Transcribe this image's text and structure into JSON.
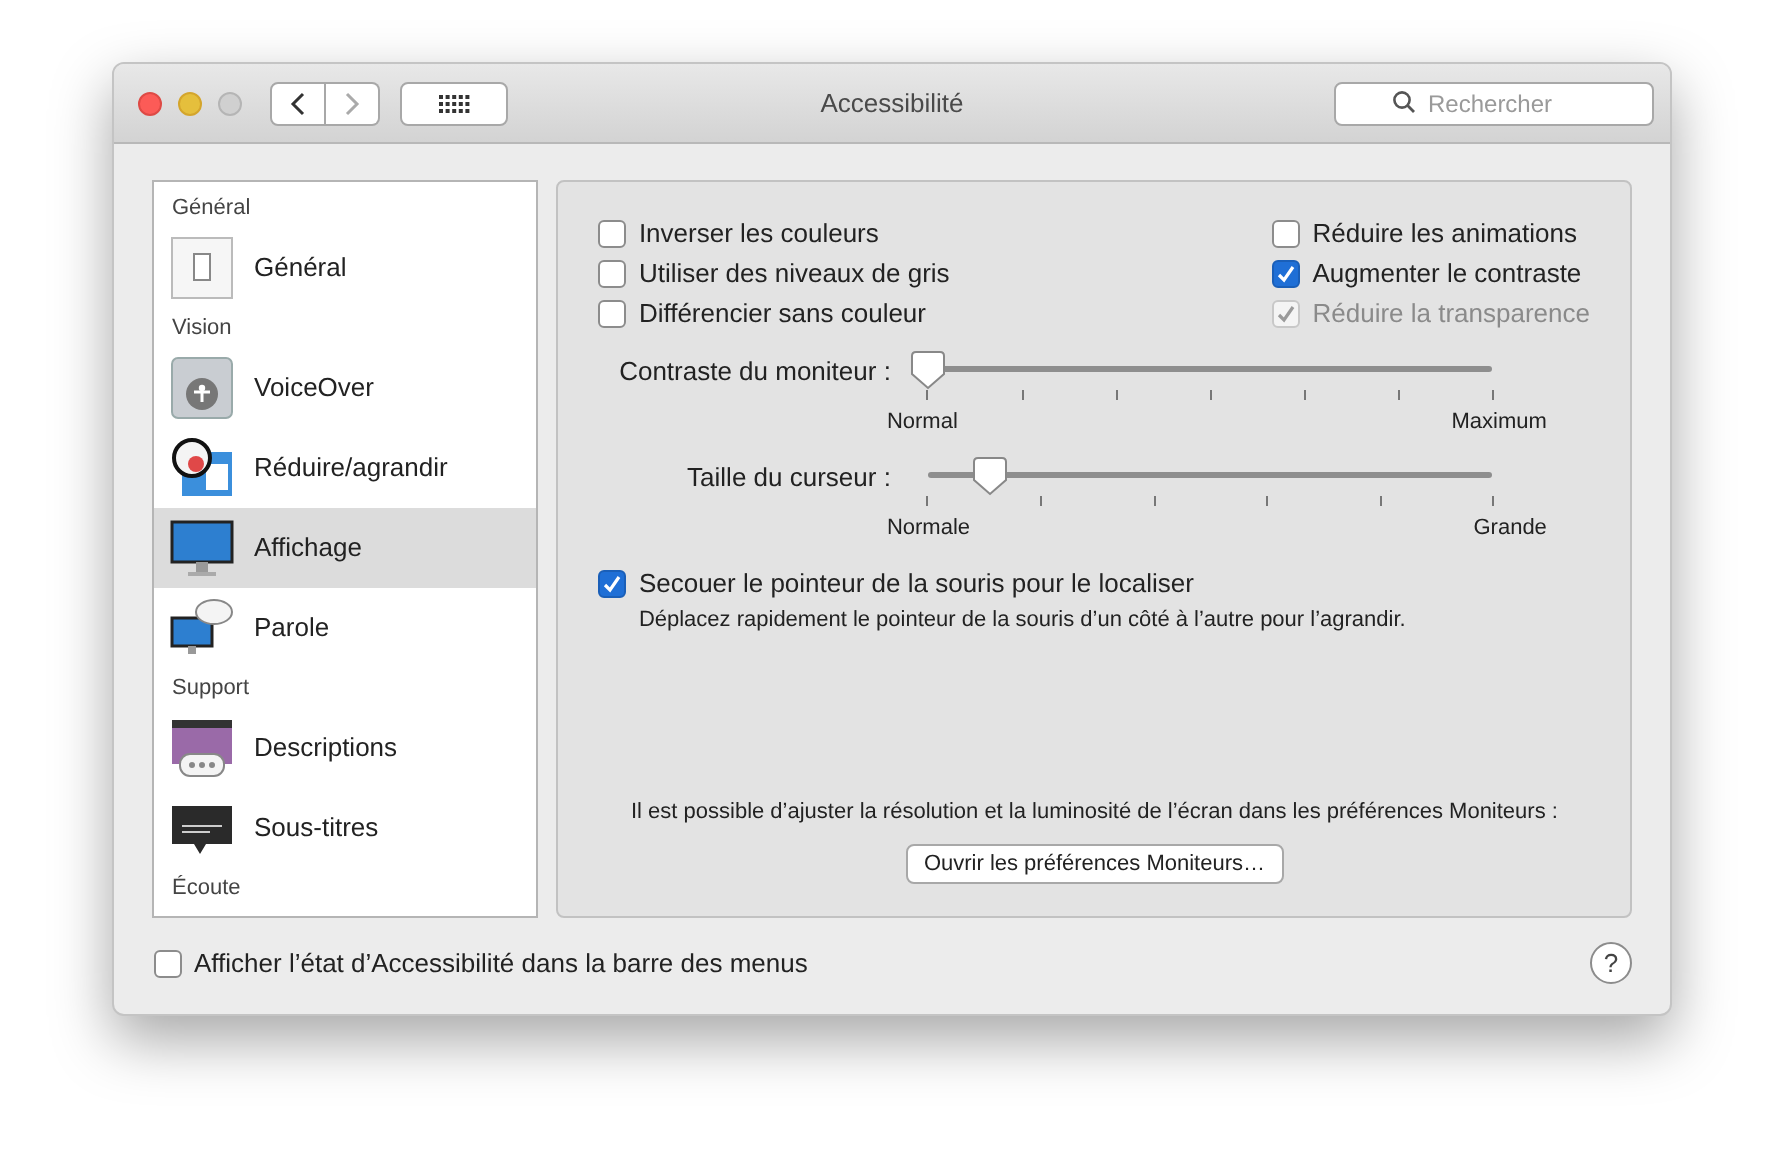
{
  "window": {
    "title": "Accessibilité"
  },
  "search": {
    "placeholder": "Rechercher"
  },
  "sidebar": {
    "items": [
      {
        "kind": "header",
        "label": "Général"
      },
      {
        "kind": "pane",
        "label": "Général",
        "selected": false
      },
      {
        "kind": "header",
        "label": "Vision"
      },
      {
        "kind": "pane",
        "label": "VoiceOver",
        "selected": false
      },
      {
        "kind": "pane",
        "label": "Réduire/agrandir",
        "selected": false
      },
      {
        "kind": "pane",
        "label": "Affichage",
        "selected": true
      },
      {
        "kind": "pane",
        "label": "Parole",
        "selected": false
      },
      {
        "kind": "header",
        "label": "Support"
      },
      {
        "kind": "pane",
        "label": "Descriptions",
        "selected": false
      },
      {
        "kind": "pane",
        "label": "Sous-titres",
        "selected": false
      },
      {
        "kind": "header",
        "label": "Écoute"
      }
    ]
  },
  "options_left": [
    {
      "label": "Inverser les couleurs",
      "checked": false,
      "disabled": false
    },
    {
      "label": "Utiliser des niveaux de gris",
      "checked": false,
      "disabled": false
    },
    {
      "label": "Différencier sans couleur",
      "checked": false,
      "disabled": false
    }
  ],
  "options_right": [
    {
      "label": "Réduire les animations",
      "checked": false,
      "disabled": false
    },
    {
      "label": "Augmenter le contraste",
      "checked": true,
      "disabled": false
    },
    {
      "label": "Réduire la transparence",
      "checked": true,
      "disabled": true
    }
  ],
  "sliders": [
    {
      "label": "Contraste du moniteur :",
      "level": 0,
      "min_label": "Normal",
      "max_label": "Maximum"
    },
    {
      "label": "Taille du curseur :",
      "level": 0.11,
      "min_label": "Normale",
      "max_label": "Grande"
    }
  ],
  "shake": {
    "label": "Secouer le pointeur de la souris pour le localiser",
    "checked": true,
    "description": "Déplacez rapidement le pointeur de la souris d’un côté à l’autre pour l’agrandir."
  },
  "display_note": "Il est possible d’ajuster la résolution et la luminosité de l’écran dans les préférences Moniteurs :",
  "display_button": "Ouvrir les préférences Moniteurs…",
  "menu_bar_option": {
    "label": "Afficher l’état d’Accessibilité dans la barre des menus",
    "checked": false
  },
  "help_button": "?"
}
